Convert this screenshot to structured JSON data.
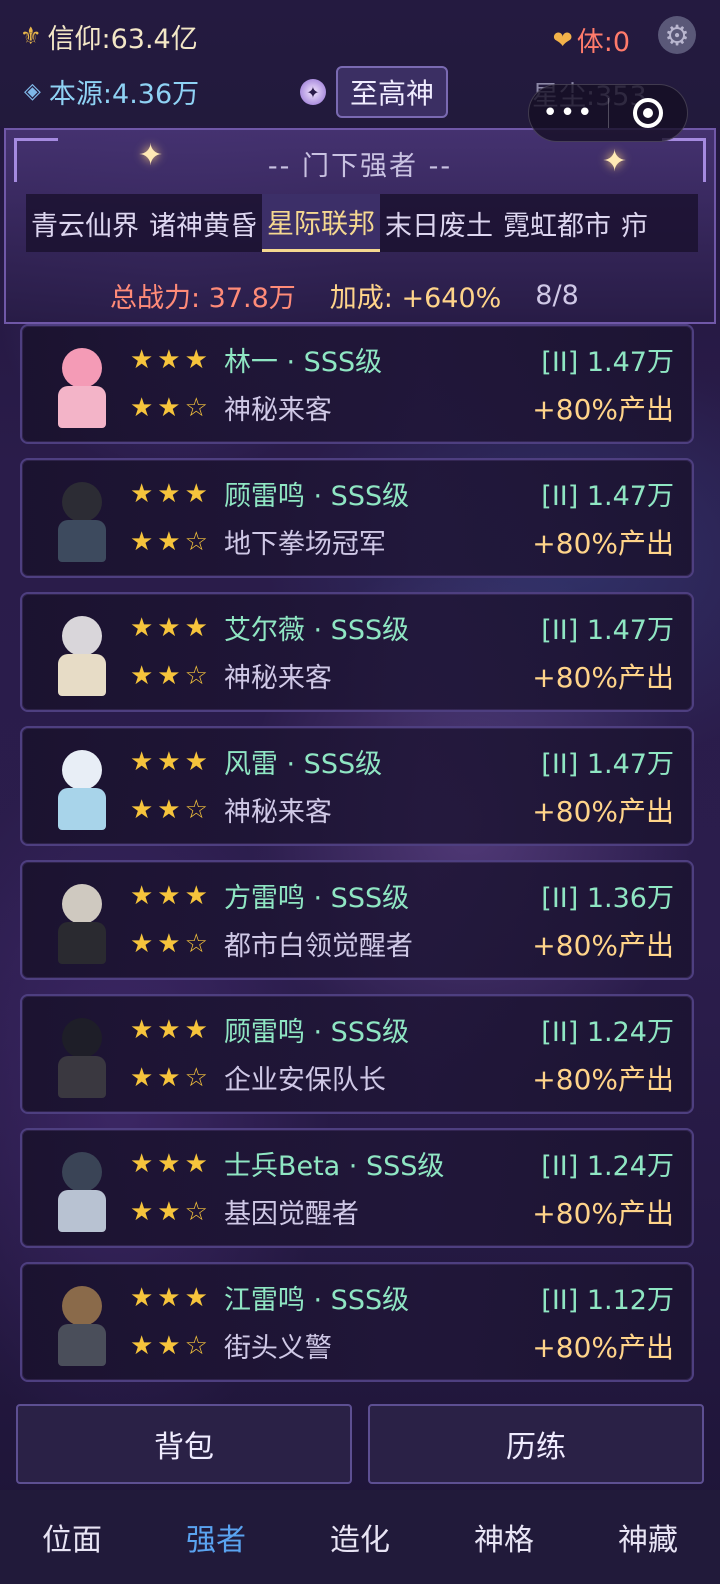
{
  "header": {
    "faith_label": "信仰:63.4亿",
    "stamina_label": "体:0",
    "origin_label": "本源:4.36万",
    "rank_button": "至高神",
    "stardust_label": "星尘:353",
    "capsule_more": "•••"
  },
  "panel": {
    "title": "-- 门下强者 --",
    "tabs": [
      "青云仙界",
      "诸神黄昏",
      "星际联邦",
      "末日废土",
      "霓虹都市",
      "疖"
    ],
    "active_tab": 2,
    "total_power": "总战力: 37.8万",
    "bonus": "加成: +640%",
    "count": "8/8"
  },
  "cards": [
    {
      "stars": "★★★",
      "name": "林一 · SSS级",
      "stars2": "★★☆",
      "title": "神秘来客",
      "power": "[II] 1.47万",
      "bonus": "+80%产出"
    },
    {
      "stars": "★★★",
      "name": "顾雷鸣 · SSS级",
      "stars2": "★★☆",
      "title": "地下拳场冠军",
      "power": "[II] 1.47万",
      "bonus": "+80%产出"
    },
    {
      "stars": "★★★",
      "name": "艾尔薇 · SSS级",
      "stars2": "★★☆",
      "title": "神秘来客",
      "power": "[II] 1.47万",
      "bonus": "+80%产出"
    },
    {
      "stars": "★★★",
      "name": "风雷 · SSS级",
      "stars2": "★★☆",
      "title": "神秘来客",
      "power": "[II] 1.47万",
      "bonus": "+80%产出"
    },
    {
      "stars": "★★★",
      "name": "方雷鸣 · SSS级",
      "stars2": "★★☆",
      "title": "都市白领觉醒者",
      "power": "[II] 1.36万",
      "bonus": "+80%产出"
    },
    {
      "stars": "★★★",
      "name": "顾雷鸣 · SSS级",
      "stars2": "★★☆",
      "title": "企业安保队长",
      "power": "[II] 1.24万",
      "bonus": "+80%产出"
    },
    {
      "stars": "★★★",
      "name": "士兵Beta · SSS级",
      "stars2": "★★☆",
      "title": "基因觉醒者",
      "power": "[II] 1.24万",
      "bonus": "+80%产出"
    },
    {
      "stars": "★★★",
      "name": "江雷鸣 · SSS级",
      "stars2": "★★☆",
      "title": "街头义警",
      "power": "[II] 1.12万",
      "bonus": "+80%产出"
    }
  ],
  "actions": {
    "bag": "背包",
    "train": "历练"
  },
  "nav": [
    {
      "label": "位面"
    },
    {
      "label": "强者"
    },
    {
      "label": "造化"
    },
    {
      "label": "神格"
    },
    {
      "label": "神藏"
    }
  ],
  "nav_active": 1,
  "colors": {
    "accent_gold": "#f5d890",
    "name_green": "#8fe6c3",
    "power_red": "#ff8b78",
    "nav_active": "#5aa3f0"
  }
}
